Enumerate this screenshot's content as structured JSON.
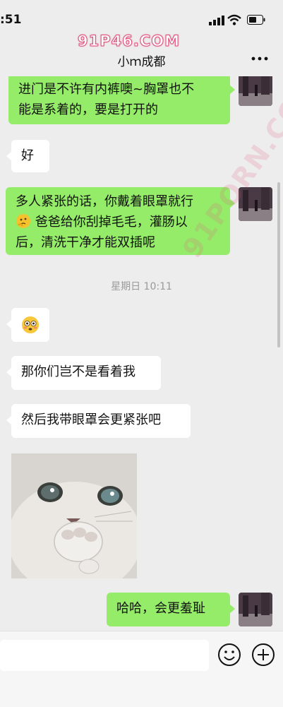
{
  "status": {
    "time": ":51"
  },
  "watermark": {
    "top": "91P46.COM",
    "diagonal": "91PORN.COM"
  },
  "header": {
    "title": "小ｍ成都"
  },
  "messages": [
    {
      "side": "me",
      "lines": [
        "进门是不许有内裤噢~胸罩也不",
        "能是系着的，要是打开的"
      ]
    },
    {
      "side": "other",
      "text": "好"
    },
    {
      "side": "me",
      "line1": "多人紧张的话，你戴着眼罩就行",
      "line2_emoji": "thinking-face",
      "line2": "爸爸给你刮掉毛毛，灌肠以",
      "line3": "后，清洗干净才能双插呢"
    },
    {
      "side": "other",
      "text": "那你们岂不是看着我"
    },
    {
      "side": "other",
      "text": "然后我带眼罩会更紧张吧"
    },
    {
      "side": "me",
      "text": "哈哈，会更羞耻"
    }
  ],
  "timestamp": "星期日 10:11",
  "stickers": {
    "surprised_emoji": "flushed-face",
    "cat": "cat-covering-mouth-sticker"
  },
  "colors": {
    "background": "#ededed",
    "my_bubble": "#95ec69",
    "other_bubble": "#ffffff"
  }
}
